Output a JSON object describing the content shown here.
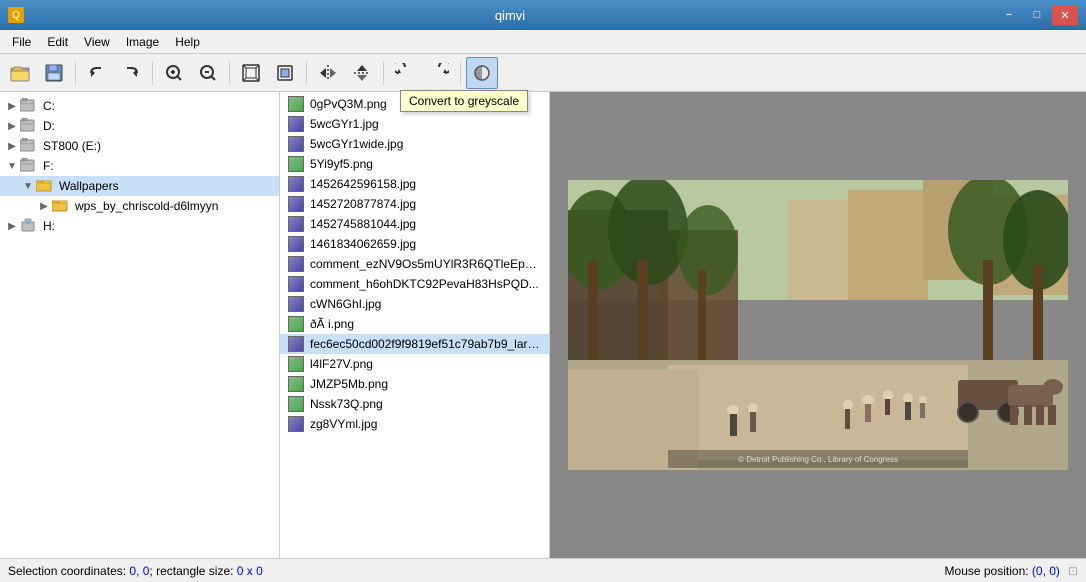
{
  "app": {
    "title": "qimvi",
    "window_icon": "Q"
  },
  "title_bar": {
    "minimize_label": "−",
    "maximize_label": "□",
    "close_label": "✕"
  },
  "menu": {
    "items": [
      "File",
      "Edit",
      "View",
      "Image",
      "Help"
    ]
  },
  "toolbar": {
    "buttons": [
      {
        "name": "open-button",
        "icon": "📂",
        "label": "Open"
      },
      {
        "name": "save-button",
        "icon": "💾",
        "label": "Save"
      },
      {
        "name": "separator1",
        "type": "separator"
      },
      {
        "name": "undo-button",
        "icon": "↩",
        "label": "Undo"
      },
      {
        "name": "redo-button",
        "icon": "↪",
        "label": "Redo"
      },
      {
        "name": "separator2",
        "type": "separator"
      },
      {
        "name": "zoom-in-button",
        "icon": "🔍",
        "label": "Zoom In"
      },
      {
        "name": "zoom-out-button",
        "icon": "🔎",
        "label": "Zoom Out"
      },
      {
        "name": "separator3",
        "type": "separator"
      },
      {
        "name": "fit-window-button",
        "icon": "⊡",
        "label": "Fit to window"
      },
      {
        "name": "actual-size-button",
        "icon": "⊞",
        "label": "Actual size"
      },
      {
        "name": "separator4",
        "type": "separator"
      },
      {
        "name": "flip-h-button",
        "icon": "↔",
        "label": "Flip horizontal"
      },
      {
        "name": "flip-v-button",
        "icon": "↕",
        "label": "Flip vertical"
      },
      {
        "name": "separator5",
        "type": "separator"
      },
      {
        "name": "rotate-ccw-button",
        "icon": "↺",
        "label": "Rotate CCW"
      },
      {
        "name": "rotate-cw-button",
        "icon": "↻",
        "label": "Rotate CW"
      },
      {
        "name": "separator6",
        "type": "separator"
      },
      {
        "name": "greyscale-button",
        "icon": "◑",
        "label": "Convert to greyscale",
        "active": true
      }
    ],
    "tooltip": "Convert to greyscale"
  },
  "tree": {
    "items": [
      {
        "label": "C:",
        "icon": "drive",
        "level": 0,
        "expanded": false
      },
      {
        "label": "D:",
        "icon": "drive",
        "level": 0,
        "expanded": false
      },
      {
        "label": "ST800 (E:)",
        "icon": "drive",
        "level": 0,
        "expanded": false
      },
      {
        "label": "F:",
        "icon": "drive",
        "level": 0,
        "expanded": true
      },
      {
        "label": "Wallpapers",
        "icon": "folder",
        "level": 1,
        "expanded": true,
        "selected": true
      },
      {
        "label": "wps_by_chriscold-d6lmyyn",
        "icon": "folder",
        "level": 2,
        "expanded": false
      },
      {
        "label": "H:",
        "icon": "network",
        "level": 0,
        "expanded": false
      }
    ]
  },
  "files": [
    {
      "name": "0gPvQ3M.png",
      "type": "png"
    },
    {
      "name": "5wcGYr1.jpg",
      "type": "jpg"
    },
    {
      "name": "5wcGYr1wide.jpg",
      "type": "jpg"
    },
    {
      "name": "5Yi9yf5.png",
      "type": "png"
    },
    {
      "name": "1452642596158.jpg",
      "type": "jpg"
    },
    {
      "name": "1452720877874.jpg",
      "type": "jpg"
    },
    {
      "name": "1452745881044.jpg",
      "type": "jpg"
    },
    {
      "name": "1461834062659.jpg",
      "type": "jpg"
    },
    {
      "name": "comment_ezNV9Os5mUYlR3R6QTleEp7...",
      "type": "jpg"
    },
    {
      "name": "comment_h6ohDKTC92PevaH83HsPQD...",
      "type": "jpg"
    },
    {
      "name": "cWN6GhI.jpg",
      "type": "jpg"
    },
    {
      "name": "ðÃ i.png",
      "type": "png"
    },
    {
      "name": "fec6ec50cd002f9f9819ef51c79ab7b9_larg...",
      "type": "jpg",
      "selected": true
    },
    {
      "name": "l4lF27V.png",
      "type": "png"
    },
    {
      "name": "JMZP5Mb.png",
      "type": "png"
    },
    {
      "name": "Nssk73Q.png",
      "type": "png"
    },
    {
      "name": "zg8VYml.jpg",
      "type": "jpg"
    }
  ],
  "status": {
    "selection": "Selection coordinates: 0, 0; rectangle size: 0 x 0",
    "mouse": "Mouse position: (0, 0)",
    "coords_text": "0, 0",
    "rect_text": "0 x 0",
    "mouse_coords": "(0, 0)"
  }
}
